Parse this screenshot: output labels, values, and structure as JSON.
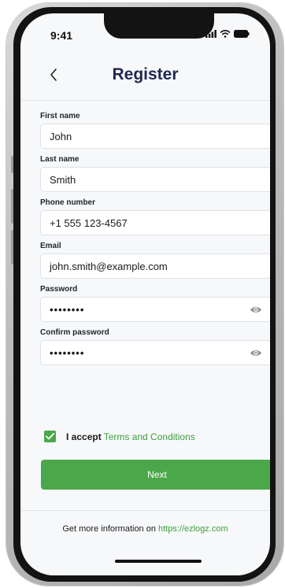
{
  "status_bar": {
    "time": "9:41"
  },
  "header": {
    "title": "Register"
  },
  "form": {
    "fields": [
      {
        "label": "First name",
        "value": "John"
      },
      {
        "label": "Last name",
        "value": "Smith"
      },
      {
        "label": "Phone number",
        "value": "+1 555 123-4567"
      },
      {
        "label": "Email",
        "value": "john.smith@example.com"
      },
      {
        "label": "Password",
        "value": "••••••••"
      },
      {
        "label": "Confirm password",
        "value": "••••••••"
      }
    ]
  },
  "terms": {
    "prefix": "I accept",
    "link_text": "Terms and Conditions",
    "checked": true
  },
  "actions": {
    "next_label": "Next"
  },
  "footer": {
    "text": "Get more information on",
    "link": "https://ezlogz.com"
  },
  "colors": {
    "accent": "#4aa84a",
    "title": "#1f2950",
    "background": "#f7f8fa"
  }
}
